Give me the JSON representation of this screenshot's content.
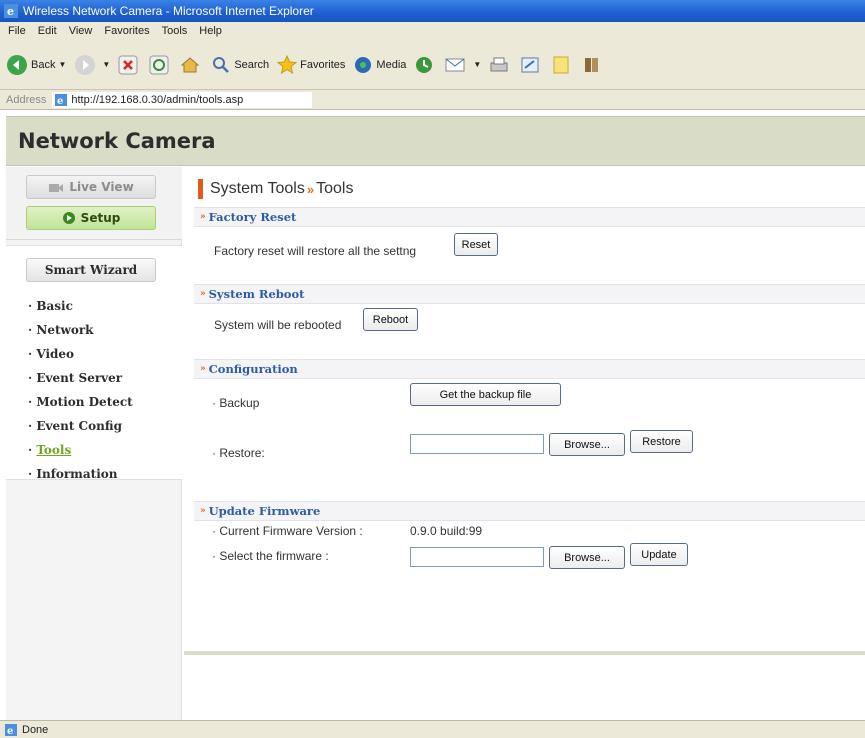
{
  "window": {
    "title": "Wireless Network Camera - Microsoft Internet Explorer"
  },
  "menu": [
    "File",
    "Edit",
    "View",
    "Favorites",
    "Tools",
    "Help"
  ],
  "toolbar": {
    "back": "Back",
    "search": "Search",
    "favorites": "Favorites",
    "media": "Media"
  },
  "address": {
    "label": "Address",
    "url": "http://192.168.0.30/admin/tools.asp"
  },
  "header": {
    "title": "Network Camera"
  },
  "sidebar": {
    "live_view": "Live View",
    "setup": "Setup",
    "smart_wizard": "Smart Wizard",
    "items": [
      {
        "label": "Basic"
      },
      {
        "label": "Network"
      },
      {
        "label": "Video"
      },
      {
        "label": "Event Server"
      },
      {
        "label": "Motion Detect"
      },
      {
        "label": "Event Config"
      },
      {
        "label": "Tools",
        "active": true
      },
      {
        "label": "Information"
      }
    ]
  },
  "main": {
    "crumb_section": "System Tools",
    "crumb_page": "Tools",
    "factory_reset": {
      "heading": "Factory Reset",
      "text": "Factory reset will restore all the settng",
      "button": "Reset"
    },
    "system_reboot": {
      "heading": "System Reboot",
      "text": "System will be rebooted",
      "button": "Reboot"
    },
    "configuration": {
      "heading": "Configuration",
      "backup_label": "Backup",
      "backup_button": "Get the backup file",
      "restore_label": "Restore:",
      "browse_button": "Browse...",
      "restore_button": "Restore"
    },
    "firmware": {
      "heading": "Update Firmware",
      "current_label": "Current Firmware Version :",
      "current_value": "0.9.0 build:99",
      "select_label": "Select the firmware :",
      "browse_button": "Browse...",
      "update_button": "Update"
    }
  },
  "status": {
    "text": "Done"
  }
}
